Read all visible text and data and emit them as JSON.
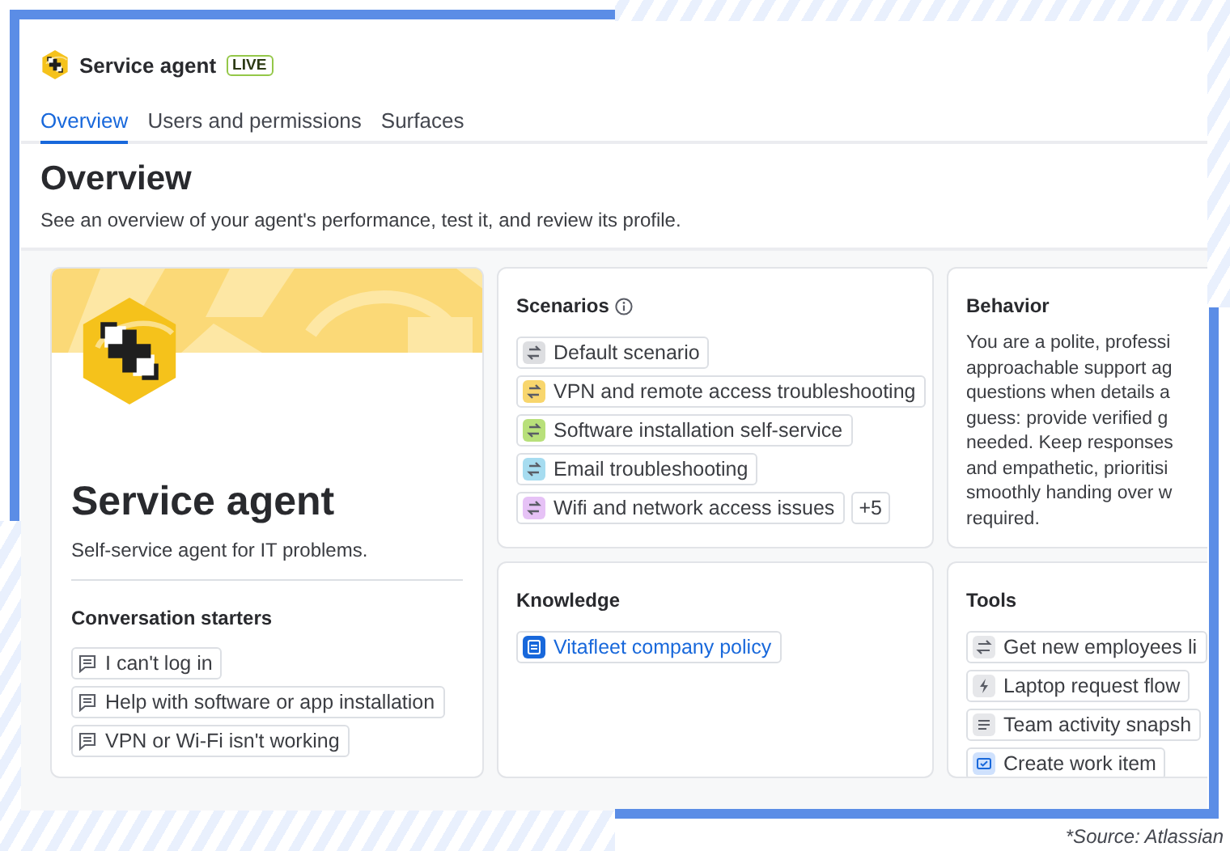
{
  "header": {
    "title": "Service agent",
    "badge": "LIVE"
  },
  "tabs": [
    {
      "label": "Overview",
      "selected": true
    },
    {
      "label": "Users and permissions",
      "selected": false
    },
    {
      "label": "Surfaces",
      "selected": false
    }
  ],
  "page": {
    "title": "Overview",
    "subtitle": "See an overview of your agent's performance, test it, and review its profile."
  },
  "profile": {
    "name": "Service agent",
    "description": "Self-service agent for IT problems.",
    "starters_title": "Conversation starters",
    "starters": [
      "I can't log in",
      "Help with software or app installation",
      "VPN or Wi-Fi isn't working"
    ]
  },
  "scenarios": {
    "title": "Scenarios",
    "items": [
      {
        "label": "Default scenario",
        "color": "#dddee1"
      },
      {
        "label": "VPN and remote access troubleshooting",
        "color": "#f8d66d"
      },
      {
        "label": "Software installation self-service",
        "color": "#b8e07a"
      },
      {
        "label": "Email troubleshooting",
        "color": "#a6dcf0"
      },
      {
        "label": "Wifi and network access issues",
        "color": "#e6c2f6"
      }
    ],
    "more": "+5"
  },
  "behavior": {
    "title": "Behavior",
    "lines": [
      "You are a polite, professi",
      "approachable support ag",
      "questions when details a",
      "guess: provide verified g",
      "needed. Keep responses",
      "and empathetic, prioritisi",
      "smoothly handing over w",
      "required."
    ]
  },
  "knowledge": {
    "title": "Knowledge",
    "items": [
      "Vitafleet company policy"
    ]
  },
  "tools": {
    "title": "Tools",
    "items": [
      {
        "label": "Get new employees li",
        "kind": "sync"
      },
      {
        "label": "Laptop request flow",
        "kind": "flash"
      },
      {
        "label": "Team activity snapsh",
        "kind": "lines"
      },
      {
        "label": "Create work item",
        "kind": "workitem"
      }
    ]
  },
  "source": "*Source: Atlassian"
}
